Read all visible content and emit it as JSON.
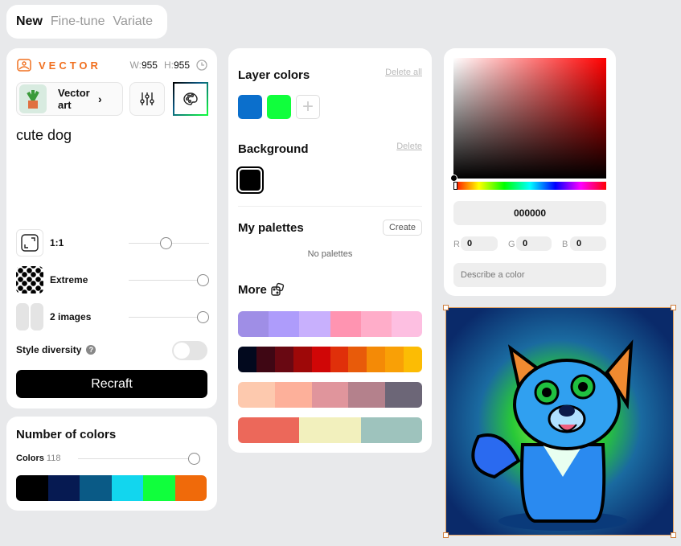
{
  "tabs": [
    {
      "label": "New",
      "active": true
    },
    {
      "label": "Fine-tune"
    },
    {
      "label": "Variate"
    }
  ],
  "left": {
    "brand": "VECTOR",
    "width_label": "W:",
    "width": "955",
    "height_label": "H:",
    "height": "955",
    "style_label": "Vector art",
    "prompt": "cute dog",
    "settings": [
      {
        "label": "1:1",
        "value_percent": 46
      },
      {
        "label": "Extreme",
        "value_percent": 92
      },
      {
        "label": "2 images",
        "value_percent": 92
      }
    ],
    "style_diversity": "Style diversity",
    "style_diversity_on": false,
    "help": "?",
    "recraft": "Recraft"
  },
  "number_of_colors": {
    "title": "Number of colors",
    "colors_label": "Colors",
    "colors_value": "118",
    "slider_percent": 95,
    "palette": [
      "#000000",
      "#061a52",
      "#0a5a86",
      "#12d6ee",
      "#10ff3c",
      "#f06a0a"
    ]
  },
  "middle": {
    "layer_colors": "Layer colors",
    "delete_all": "Delete all",
    "layer_swatches": [
      "#0b6fcc",
      "#10ff3c"
    ],
    "background": "Background",
    "delete": "Delete",
    "background_color": "#000000",
    "my_palettes": "My palettes",
    "create": "Create",
    "no_palettes": "No palettes",
    "more": "More",
    "palettes": [
      [
        "#9f8ee6",
        "#ae9cfb",
        "#c8b0fd",
        "#ff94b1",
        "#ffadc9",
        "#fdbfe1"
      ],
      [
        "#02091e",
        "#3f0714",
        "#690812",
        "#9e0808",
        "#d00606",
        "#e0300a",
        "#e85b0a",
        "#f48a06",
        "#f9a006",
        "#fcbc04"
      ],
      [
        "#fdc9ae",
        "#fdb09a",
        "#e0959c",
        "#b4818c",
        "#6c6677"
      ],
      [
        "#ec685a",
        "#f2f0bd",
        "#9ec3bd"
      ]
    ]
  },
  "color_picker": {
    "hex": "000000",
    "r_label": "R",
    "r": "0",
    "g_label": "G",
    "g": "0",
    "b_label": "B",
    "b": "0",
    "describe_placeholder": "Describe a color"
  }
}
